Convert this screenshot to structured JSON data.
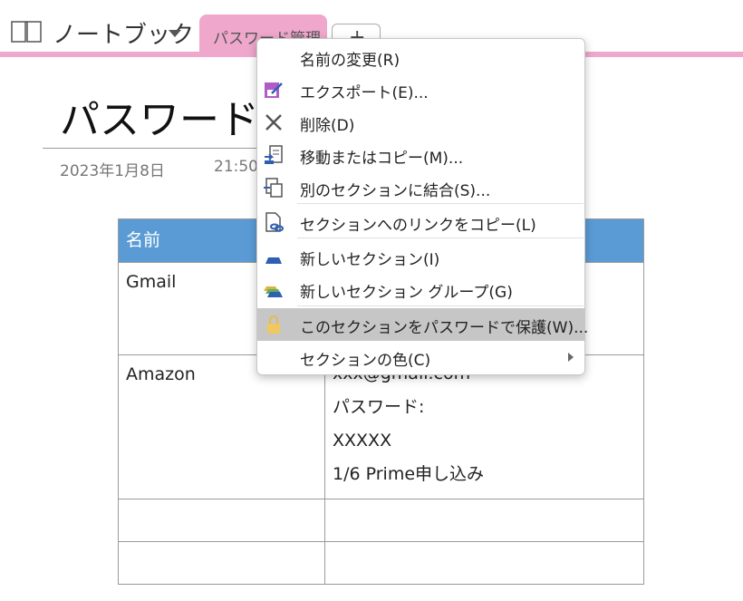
{
  "notebook": {
    "title": "ノートブック",
    "section_tab": "パスワード管理",
    "add_tab": "+"
  },
  "page": {
    "title": "パスワード管",
    "date": "2023年1月8日",
    "time": "21:50"
  },
  "table": {
    "header": [
      "名前",
      ""
    ],
    "rows": [
      {
        "name": "Gmail",
        "details": []
      },
      {
        "name": "Amazon",
        "details": [
          "xxx@gmail.com",
          "パスワード:",
          "XXXXX",
          "1/6 Prime申し込み"
        ]
      },
      {
        "name": "",
        "details": []
      },
      {
        "name": "",
        "details": []
      }
    ]
  },
  "context_menu": {
    "items": [
      {
        "label": "名前の変更(R)",
        "icon": "none"
      },
      {
        "label": "エクスポート(E)...",
        "icon": "export-icon"
      },
      {
        "label": "削除(D)",
        "icon": "delete-icon"
      },
      {
        "label": "移動またはコピー(M)...",
        "icon": "move-copy-icon"
      },
      {
        "label": "別のセクションに結合(S)...",
        "icon": "merge-icon"
      },
      {
        "label": "セクションへのリンクをコピー(L)",
        "icon": "link-icon"
      },
      {
        "label": "新しいセクション(I)",
        "icon": "new-section-icon"
      },
      {
        "label": "新しいセクション グループ(G)",
        "icon": "new-section-group-icon"
      },
      {
        "label": "このセクションをパスワードで保護(W)...",
        "icon": "lock-icon",
        "highlighted": true
      },
      {
        "label": "セクションの色(C)",
        "icon": "none",
        "submenu": true
      }
    ]
  },
  "colors": {
    "accent_pink": "#efa7cc",
    "table_header": "#5b9bd5",
    "menu_highlight": "#c6c6c6"
  }
}
